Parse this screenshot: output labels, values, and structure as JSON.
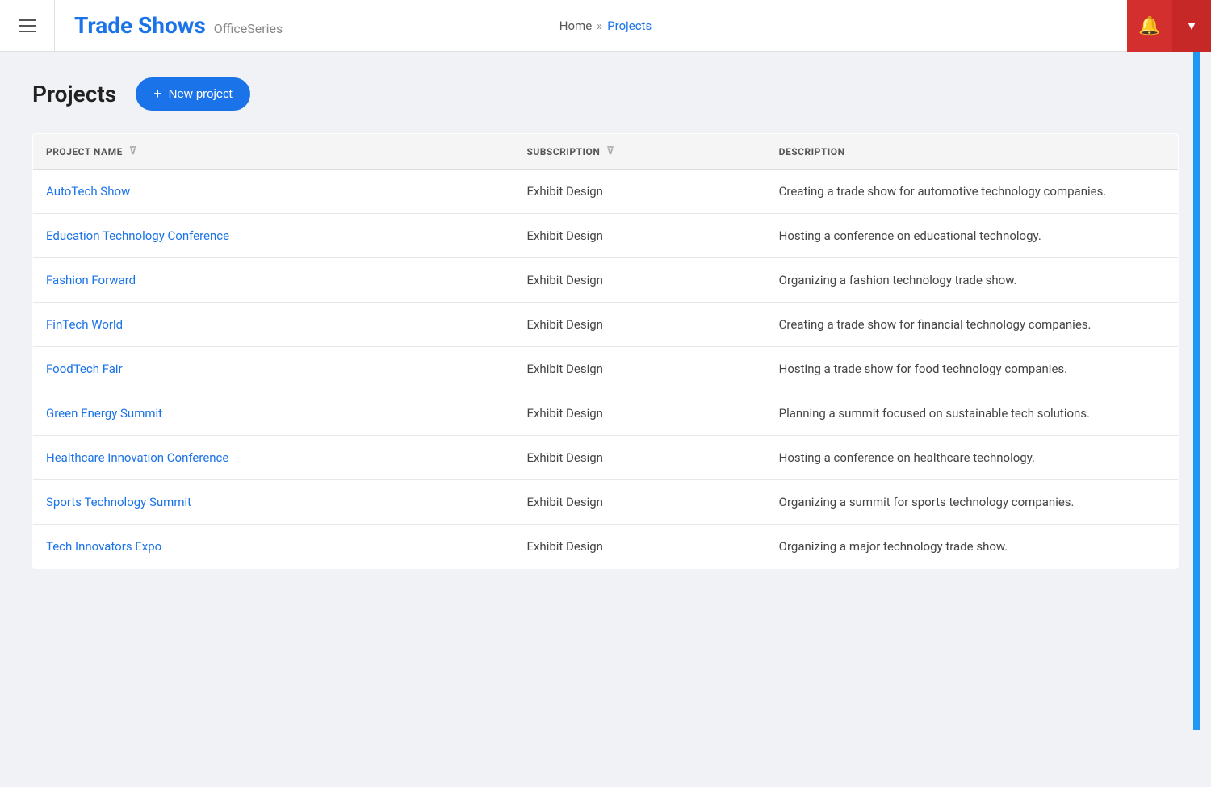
{
  "header": {
    "menu_label": "Menu",
    "app_title": "Trade Shows",
    "app_subtitle": "OfficeSeries",
    "nav_home": "Home",
    "nav_separator": "»",
    "nav_current": "Projects",
    "bell_label": "Notifications",
    "dropdown_label": "User menu"
  },
  "page": {
    "title": "Projects",
    "new_project_button": "+ New project"
  },
  "table": {
    "columns": [
      {
        "key": "project_name",
        "label": "PROJECT NAME"
      },
      {
        "key": "subscription",
        "label": "SUBSCRIPTION"
      },
      {
        "key": "description",
        "label": "DESCRIPTION"
      }
    ],
    "rows": [
      {
        "project_name": "AutoTech Show",
        "subscription": "Exhibit Design",
        "description": "Creating a trade show for automotive technology companies."
      },
      {
        "project_name": "Education Technology Conference",
        "subscription": "Exhibit Design",
        "description": "Hosting a conference on educational technology."
      },
      {
        "project_name": "Fashion Forward",
        "subscription": "Exhibit Design",
        "description": "Organizing a fashion technology trade show."
      },
      {
        "project_name": "FinTech World",
        "subscription": "Exhibit Design",
        "description": "Creating a trade show for financial technology companies."
      },
      {
        "project_name": "FoodTech Fair",
        "subscription": "Exhibit Design",
        "description": "Hosting a trade show for food technology companies."
      },
      {
        "project_name": "Green Energy Summit",
        "subscription": "Exhibit Design",
        "description": "Planning a summit focused on sustainable tech solutions."
      },
      {
        "project_name": "Healthcare Innovation Conference",
        "subscription": "Exhibit Design",
        "description": "Hosting a conference on healthcare technology."
      },
      {
        "project_name": "Sports Technology Summit",
        "subscription": "Exhibit Design",
        "description": "Organizing a summit for sports technology companies."
      },
      {
        "project_name": "Tech Innovators Expo",
        "subscription": "Exhibit Design",
        "description": "Organizing a major technology trade show."
      }
    ]
  }
}
